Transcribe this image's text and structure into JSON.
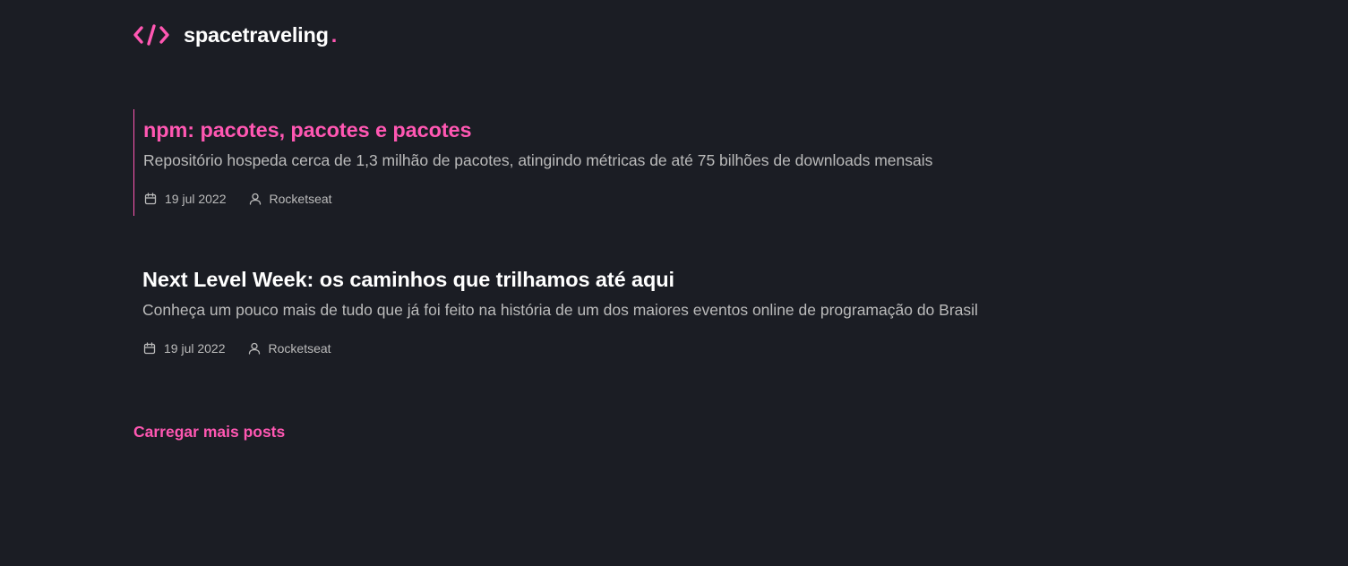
{
  "header": {
    "logo_icon": "code-brackets-icon",
    "logo_text": "spacetraveling",
    "logo_dot": ".",
    "accent_color": "#ff57b2"
  },
  "posts": [
    {
      "title": "npm: pacotes, pacotes e pacotes",
      "subtitle": "Repositório hospeda cerca de 1,3 milhão de pacotes, atingindo métricas de até 75 bilhões de downloads mensais",
      "date": "19 jul 2022",
      "author": "Rocketseat",
      "date_icon": "calendar-icon",
      "author_icon": "user-icon",
      "highlighted": true
    },
    {
      "title": "Next Level Week: os caminhos que trilhamos até aqui",
      "subtitle": "Conheça um pouco mais de tudo que já foi feito na história de um dos maiores eventos online de programação do Brasil",
      "date": "19 jul 2022",
      "author": "Rocketseat",
      "date_icon": "calendar-icon",
      "author_icon": "user-icon",
      "highlighted": false
    }
  ],
  "load_more": {
    "label": "Carregar mais posts"
  },
  "colors": {
    "background": "#1b1d24",
    "accent": "#ff57b2",
    "text": "#ffffff",
    "muted": "#bbbbbb"
  }
}
